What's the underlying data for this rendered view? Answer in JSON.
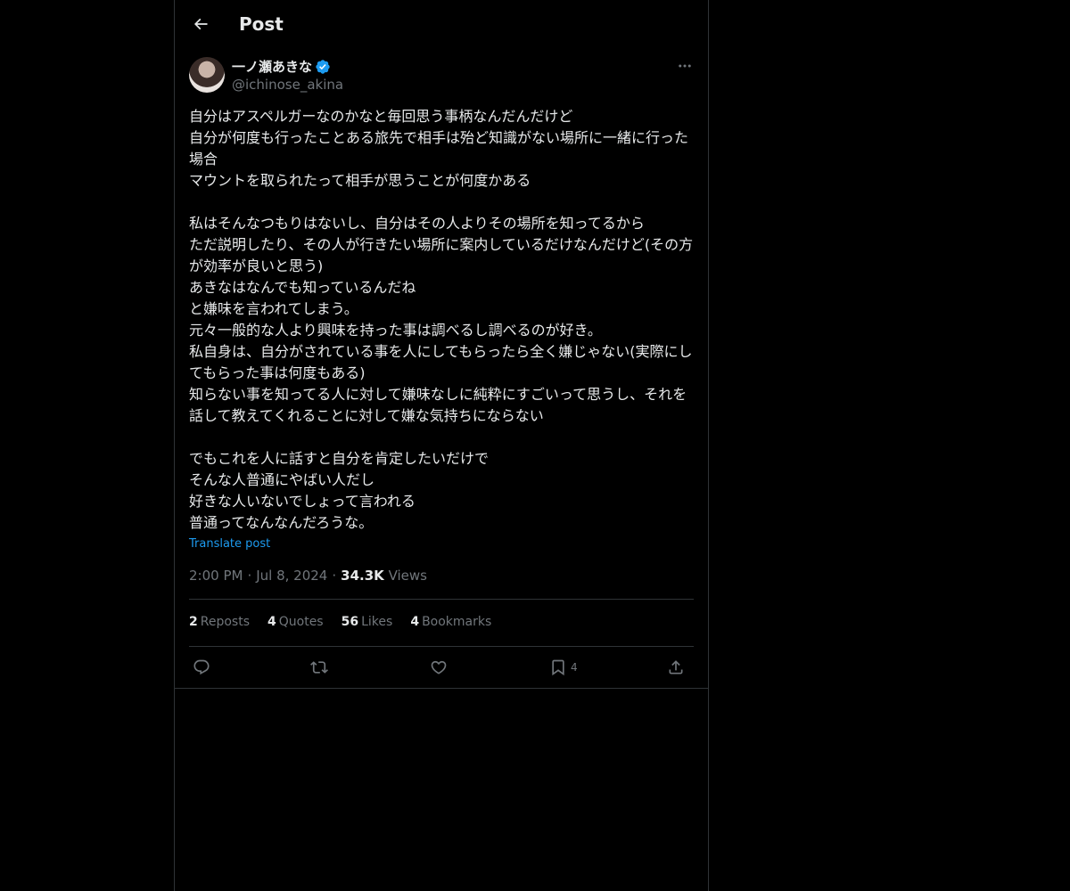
{
  "header": {
    "title": "Post"
  },
  "post": {
    "author": {
      "display_name": "一ノ瀬あきな",
      "handle": "@ichinose_akina",
      "verified": true
    },
    "text": "自分はアスペルガーなのかなと毎回思う事柄なんだんだけど\n自分が何度も行ったことある旅先で相手は殆ど知識がない場所に一緒に行った場合\nマウントを取られたって相手が思うことが何度かある\n\n私はそんなつもりはないし、自分はその人よりその場所を知ってるから\nただ説明したり、その人が行きたい場所に案内しているだけなんだけど(その方が効率が良いと思う)\nあきなはなんでも知っているんだね\nと嫌味を言われてしまう。\n元々一般的な人より興味を持った事は調べるし調べるのが好き。\n私自身は、自分がされている事を人にしてもらったら全く嫌じゃない(実際にしてもらった事は何度もある)\n知らない事を知ってる人に対して嫌味なしに純粋にすごいって思うし、それを話して教えてくれることに対して嫌な気持ちにならない\n\nでもこれを人に話すと自分を肯定したいだけで\nそんな人普通にやばい人だし\n好きな人いないでしょって言われる\n普通ってなんなんだろうな。",
    "translate_label": "Translate post",
    "time": "2:00 PM",
    "date": "Jul 8, 2024",
    "views_count": "34.3K",
    "views_label": "Views"
  },
  "stats": {
    "reposts": {
      "count": "2",
      "label": "Reposts"
    },
    "quotes": {
      "count": "4",
      "label": "Quotes"
    },
    "likes": {
      "count": "56",
      "label": "Likes"
    },
    "bookmarks": {
      "count": "4",
      "label": "Bookmarks"
    }
  },
  "actions": {
    "bookmark_count": "4"
  },
  "icons": {
    "back": "arrow-left-icon",
    "verified": "verified-badge-icon",
    "more": "more-horizontal-icon",
    "reply": "reply-icon",
    "repost": "repost-icon",
    "like": "heart-icon",
    "bookmark": "bookmark-icon",
    "share": "share-icon"
  },
  "colors": {
    "background": "#000000",
    "text": "#e7e9ea",
    "muted": "#71767b",
    "accent": "#1d9bf0",
    "border": "#2f3336"
  }
}
